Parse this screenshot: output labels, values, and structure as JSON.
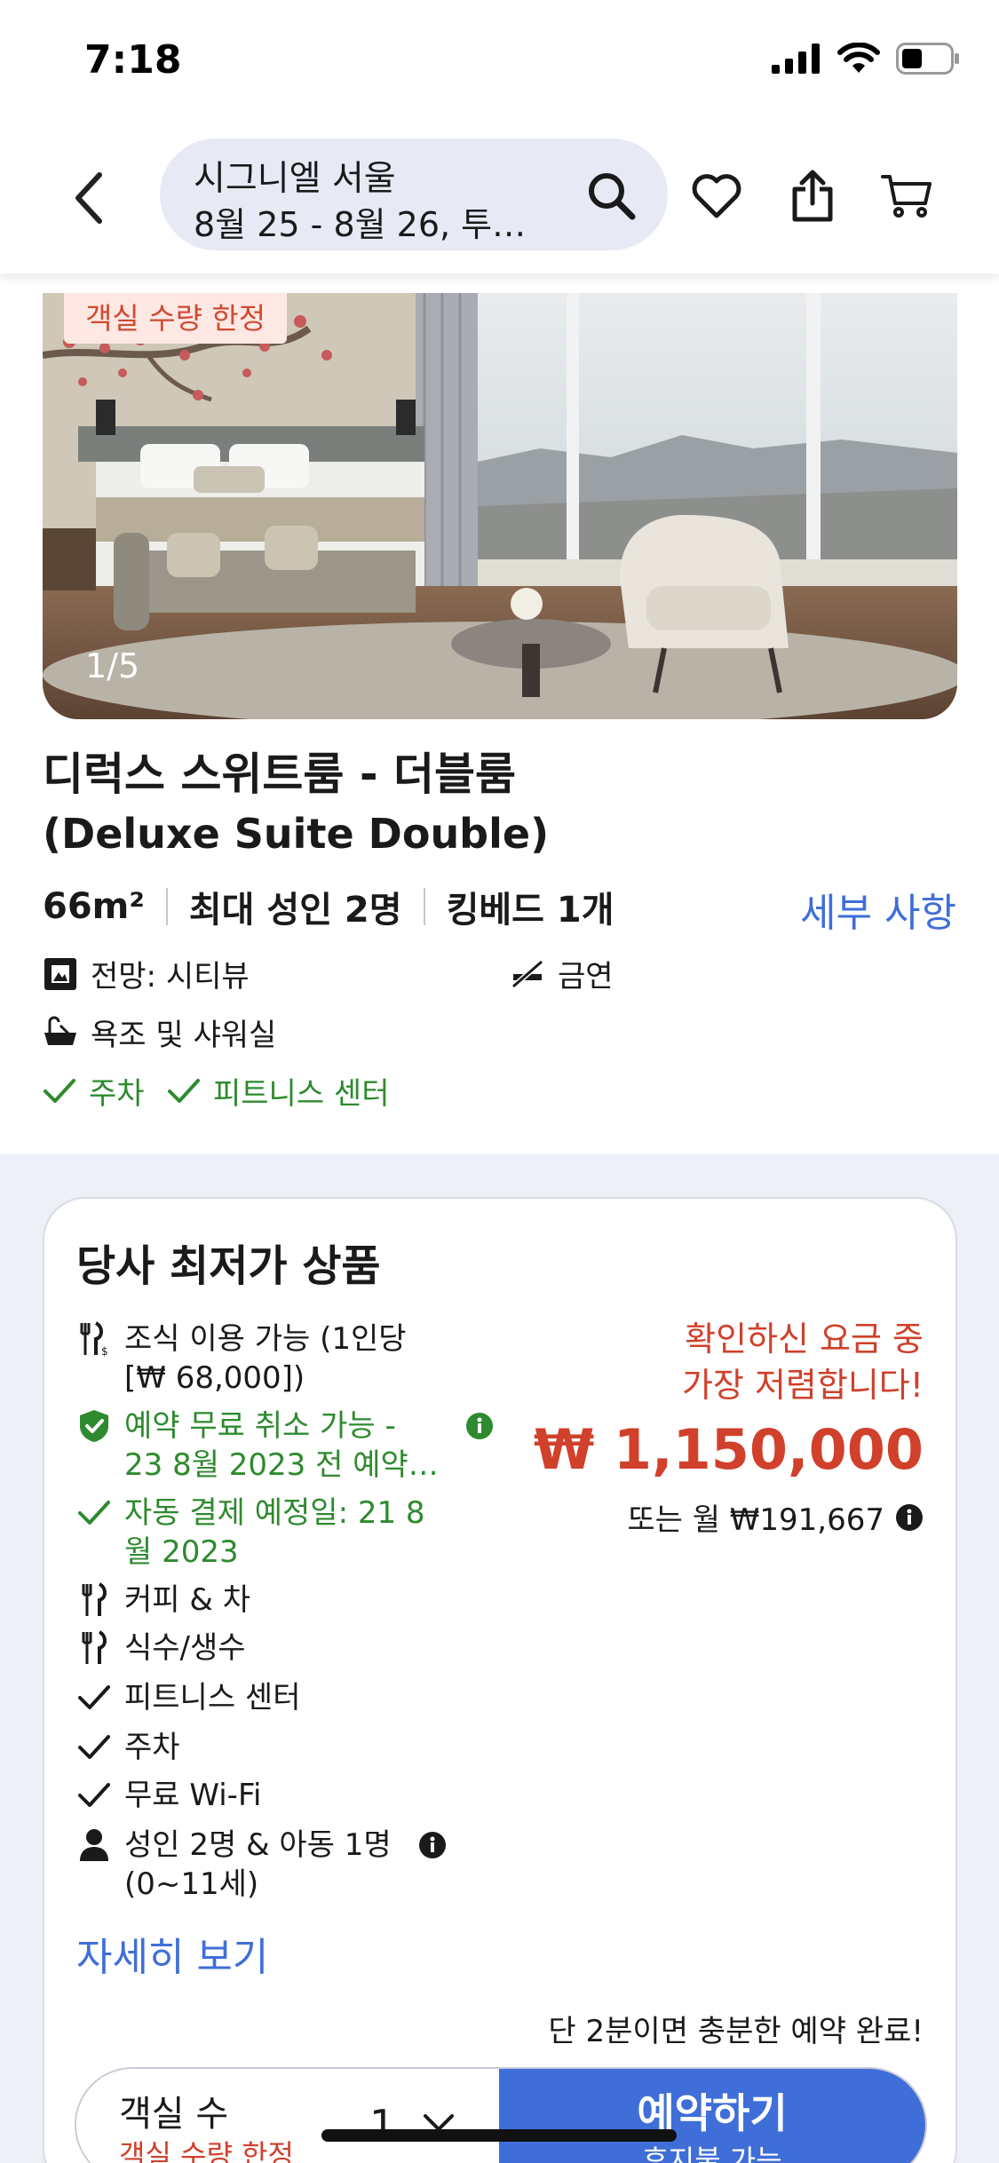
{
  "status_bar": {
    "time": "7:18"
  },
  "header": {
    "search_title": "시그니엘 서울",
    "search_subtitle": "8월 25 - 8월 26, 투…"
  },
  "hero": {
    "badge": "객실 수량 한정",
    "counter": "1/5"
  },
  "room": {
    "name": "디럭스 스위트룸 - 더블룸",
    "name_en": "(Deluxe Suite Double)",
    "size": "66m²",
    "occupancy": "최대 성인 2명",
    "bed": "킹베드 1개",
    "details_link": "세부 사항",
    "amenities": {
      "view": "전망: 시티뷰",
      "smoking": "금연",
      "bath": "욕조 및 샤워실",
      "parking": "주차",
      "fitness": "피트니스 센터"
    }
  },
  "offer": {
    "title": "당사 최저가 상품",
    "features": {
      "breakfast_line1": "조식 이용 가능 (1인당",
      "breakfast_line2": "[₩ 68,000])",
      "cancel_line1": "예약 무료 취소 가능 -",
      "cancel_line2": "23 8월 2023 전 예약…",
      "payment_line1": "자동 결제 예정일: 21 8",
      "payment_line2": "월 2023",
      "coffee": "커피 & 차",
      "water": "식수/생수",
      "fitness": "피트니스 센터",
      "parking": "주차",
      "wifi": "무료 Wi-Fi",
      "guests_line1": "성인 2명 & 아동 1명",
      "guests_line2": "(0~11세)"
    },
    "best_price_line1": "확인하신 요금 중",
    "best_price_line2": "가장 저렴합니다!",
    "price": "₩ 1,150,000",
    "monthly": "또는 월 ₩191,667",
    "more_link": "자세히 보기",
    "fast_note": "단 2분이면 충분한 예약 완료!",
    "rooms_label": "객실 수",
    "rooms_sub": "객실 수량 한정",
    "rooms_qty": "1",
    "book_label": "예약하기",
    "book_sub": "후지불 가능"
  },
  "colors": {
    "accent": "#3f6ed8",
    "price_red": "#d0402b",
    "green": "#2e8a2e",
    "pill_bg": "#e7eaf5"
  }
}
